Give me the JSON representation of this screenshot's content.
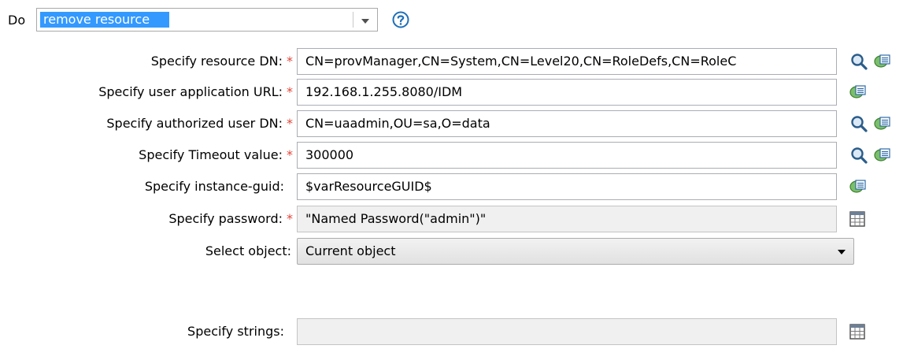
{
  "action": {
    "label": "Do",
    "value": "remove resource",
    "help_icon": "help-icon"
  },
  "rows": [
    {
      "label": "Specify resource DN:",
      "required": true,
      "value": "CN=provManager,CN=System,CN=Level20,CN=RoleDefs,CN=RoleC"
    },
    {
      "label": "Specify user application URL:",
      "required": true,
      "value": "192.168.1.255.8080/IDM"
    },
    {
      "label": "Specify authorized user DN:",
      "required": true,
      "value": "CN=uaadmin,OU=sa,O=data"
    },
    {
      "label": "Specify Timeout value:",
      "required": true,
      "value": "300000"
    },
    {
      "label": "Specify instance-guid:",
      "required": false,
      "value": "$varResourceGUID$"
    },
    {
      "label": "Specify password:",
      "required": true,
      "value": "\"Named Password(\"admin\")\""
    },
    {
      "label": "Select object:",
      "required": false,
      "value": "Current object"
    },
    {
      "label": "Specify strings:",
      "required": false,
      "value": ""
    }
  ],
  "required_marker": "*",
  "icons": {
    "browse": "magnifier-icon",
    "argument_builder": "argument-builder-icon",
    "list_editor": "list-editor-icon"
  },
  "colors": {
    "selection": "#3399ff",
    "required": "#e0463a"
  }
}
